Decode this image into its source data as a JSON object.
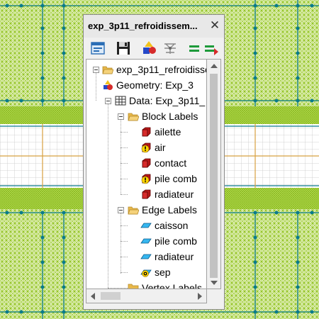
{
  "panel": {
    "title": "exp_3p11_refroidissem...",
    "close_glyph": "✕"
  },
  "toolbar": {
    "buttons": [
      {
        "icon": "window-icon"
      },
      {
        "icon": "save-icon"
      },
      {
        "icon": "shapes-icon"
      },
      {
        "icon": "mesh-icon"
      },
      {
        "icon": "equals-icon"
      },
      {
        "icon": "equals-arrow-icon"
      }
    ]
  },
  "tree": {
    "root": "exp_3p11_refroidisse",
    "geometry": "Geometry: Exp_3",
    "data": "Data: Exp_3p11_",
    "block_labels": {
      "label": "Block Labels",
      "items": [
        "ailette",
        "air",
        "contact",
        "pile comb",
        "radiateur"
      ]
    },
    "edge_labels": {
      "label": "Edge Labels",
      "items": [
        "caisson",
        "pile comb",
        "radiateur",
        "sep"
      ]
    },
    "vertex_labels": {
      "label": "Vertex Labels"
    }
  },
  "colors": {
    "mesh_green": "#8cc016",
    "node_teal": "#0a7b8c",
    "grid_gray": "#c8c8c8",
    "accent_orange": "#d8a040"
  }
}
